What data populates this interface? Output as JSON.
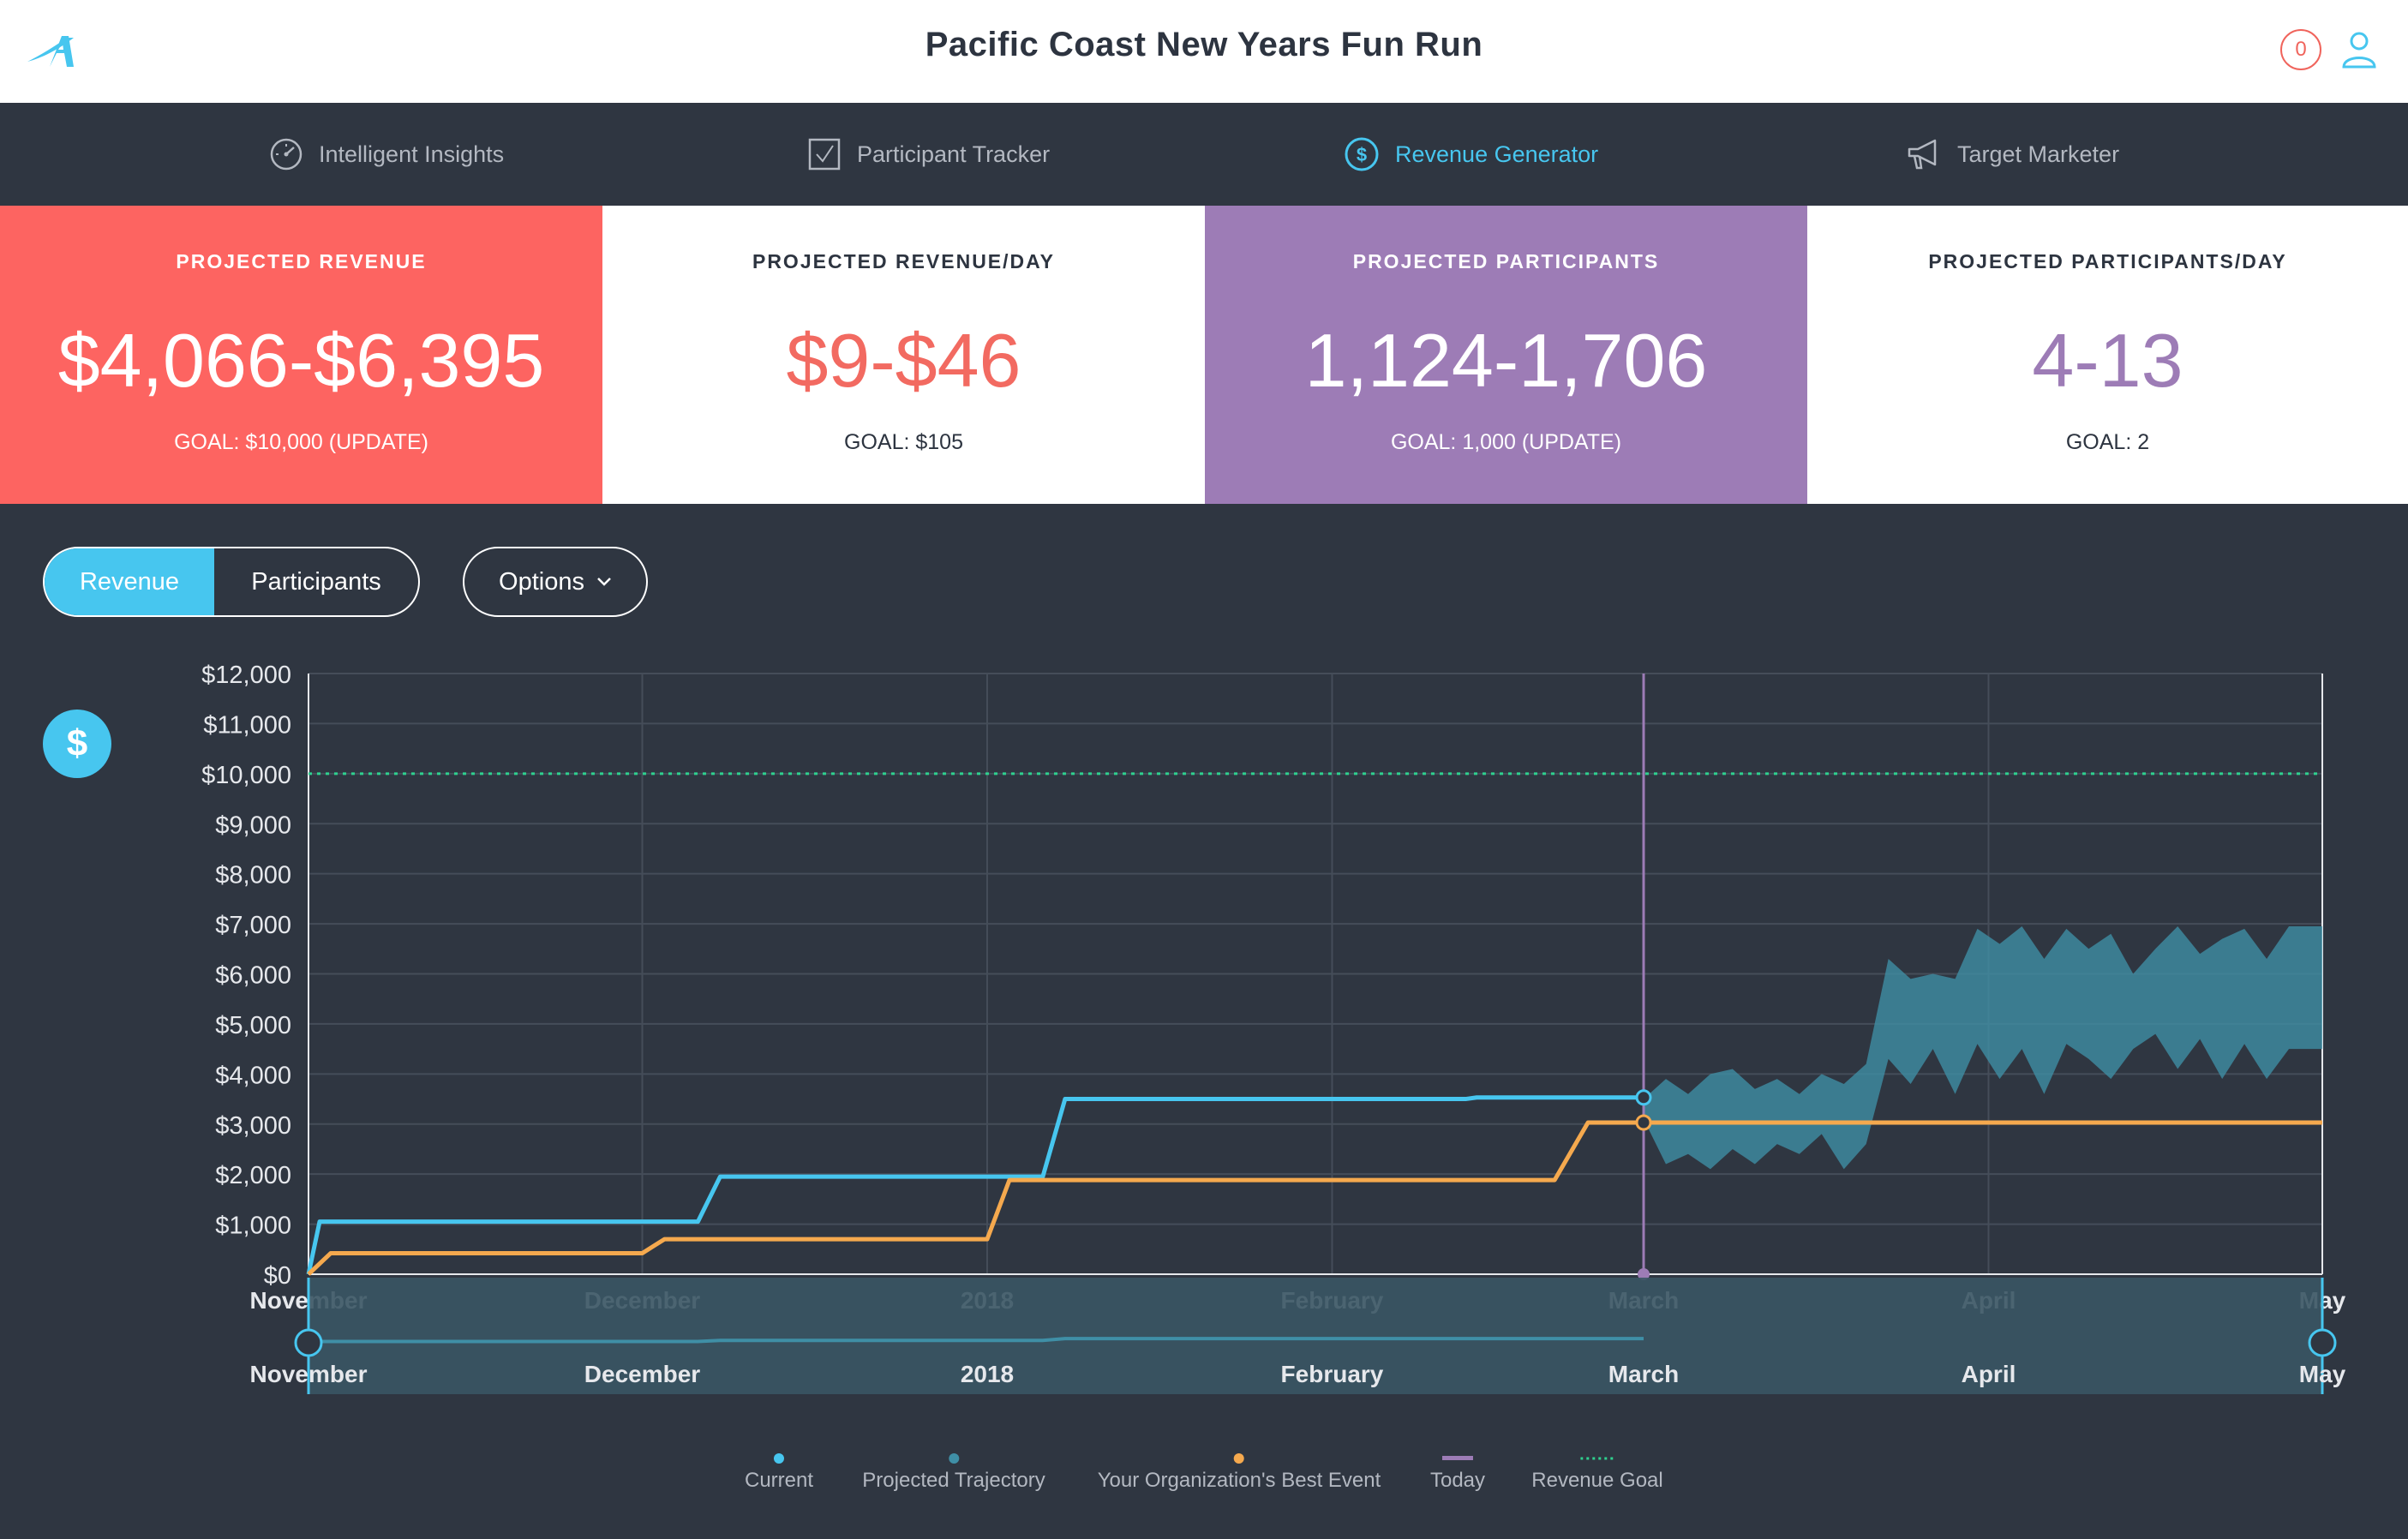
{
  "header": {
    "title": "Pacific Coast New Years Fun Run",
    "notification_count": "0",
    "logo_icon": "brand-logo-icon",
    "user_icon": "user-icon"
  },
  "nav": {
    "items": [
      {
        "label": "Intelligent Insights",
        "icon": "speedometer-icon",
        "active": false
      },
      {
        "label": "Participant Tracker",
        "icon": "checkbox-icon",
        "active": false
      },
      {
        "label": "Revenue Generator",
        "icon": "dollar-circle-icon",
        "active": true
      },
      {
        "label": "Target Marketer",
        "icon": "megaphone-icon",
        "active": false
      }
    ]
  },
  "cards": [
    {
      "label": "PROJECTED REVENUE",
      "value": "$4,066-$6,395",
      "goal": "GOAL: $10,000 (UPDATE)"
    },
    {
      "label": "PROJECTED REVENUE/DAY",
      "value": "$9-$46",
      "goal": "GOAL: $105"
    },
    {
      "label": "PROJECTED PARTICIPANTS",
      "value": "1,124-1,706",
      "goal": "GOAL: 1,000 (UPDATE)"
    },
    {
      "label": "PROJECTED PARTICIPANTS/DAY",
      "value": "4-13",
      "goal": "GOAL: 2"
    }
  ],
  "controls": {
    "toggle": [
      "Revenue",
      "Participants"
    ],
    "active_toggle": "Revenue",
    "options_label": "Options",
    "badge_symbol": "$"
  },
  "colors": {
    "current": "#47c6ef",
    "projected": "#3f8fa6",
    "best_event": "#f5a94e",
    "today": "#9d7cb6",
    "goal": "#2fd18f",
    "red": "#fd6461",
    "purple": "#9d7cb6"
  },
  "chart_data": {
    "type": "line",
    "y_ticks": [
      "$0",
      "$1,000",
      "$2,000",
      "$3,000",
      "$4,000",
      "$5,000",
      "$6,000",
      "$7,000",
      "$8,000",
      "$9,000",
      "$10,000",
      "$11,000",
      "$12,000"
    ],
    "ylim": [
      0,
      12000
    ],
    "x_ticks": [
      "November",
      "December",
      "2018",
      "February",
      "March",
      "April",
      "May"
    ],
    "xlim": [
      "2017-11-01",
      "2018-05-01"
    ],
    "today": "2018-03-01",
    "goal": 10000,
    "series": [
      {
        "name": "Current",
        "key": "current",
        "points": [
          [
            "2017-11-01",
            0
          ],
          [
            "2017-11-02",
            1050
          ],
          [
            "2017-12-06",
            1050
          ],
          [
            "2017-12-08",
            1950
          ],
          [
            "2018-01-06",
            1950
          ],
          [
            "2018-01-08",
            3500
          ],
          [
            "2018-02-13",
            3500
          ],
          [
            "2018-02-14",
            3530
          ],
          [
            "2018-03-01",
            3530
          ]
        ]
      },
      {
        "name": "Your Organization's Best Event",
        "key": "best_event",
        "points": [
          [
            "2017-11-01",
            0
          ],
          [
            "2017-11-03",
            420
          ],
          [
            "2017-12-01",
            420
          ],
          [
            "2017-12-03",
            700
          ],
          [
            "2018-01-01",
            700
          ],
          [
            "2018-01-03",
            1880
          ],
          [
            "2018-02-21",
            1880
          ],
          [
            "2018-02-24",
            3030
          ],
          [
            "2018-05-01",
            3030
          ]
        ]
      },
      {
        "name": "Projected Trajectory",
        "key": "projected",
        "band": [
          [
            "2018-03-01",
            3500,
            3100
          ],
          [
            "2018-03-03",
            3900,
            2200
          ],
          [
            "2018-03-05",
            3600,
            2400
          ],
          [
            "2018-03-07",
            4000,
            2100
          ],
          [
            "2018-03-09",
            4100,
            2500
          ],
          [
            "2018-03-11",
            3700,
            2200
          ],
          [
            "2018-03-13",
            3900,
            2600
          ],
          [
            "2018-03-15",
            3600,
            2400
          ],
          [
            "2018-03-17",
            4000,
            2800
          ],
          [
            "2018-03-19",
            3800,
            2100
          ],
          [
            "2018-03-21",
            4200,
            2600
          ],
          [
            "2018-03-23",
            6300,
            4300
          ],
          [
            "2018-03-25",
            5900,
            3800
          ],
          [
            "2018-03-27",
            6000,
            4500
          ],
          [
            "2018-03-29",
            5900,
            3600
          ],
          [
            "2018-03-31",
            6900,
            4600
          ],
          [
            "2018-04-02",
            6600,
            3900
          ],
          [
            "2018-04-04",
            6950,
            4500
          ],
          [
            "2018-04-06",
            6300,
            3600
          ],
          [
            "2018-04-08",
            6900,
            4600
          ],
          [
            "2018-04-10",
            6500,
            4300
          ],
          [
            "2018-04-12",
            6800,
            3900
          ],
          [
            "2018-04-14",
            6000,
            4500
          ],
          [
            "2018-04-16",
            6500,
            4800
          ],
          [
            "2018-04-18",
            6950,
            4100
          ],
          [
            "2018-04-20",
            6400,
            4700
          ],
          [
            "2018-04-22",
            6700,
            3900
          ],
          [
            "2018-04-24",
            6900,
            4600
          ],
          [
            "2018-04-26",
            6300,
            3900
          ],
          [
            "2018-04-28",
            6950,
            4500
          ]
        ]
      }
    ]
  },
  "legend": [
    {
      "label": "Current",
      "style": "dot",
      "color_key": "current"
    },
    {
      "label": "Projected Trajectory",
      "style": "dot",
      "color_key": "projected"
    },
    {
      "label": "Your Organization's Best Event",
      "style": "dot",
      "color_key": "best_event"
    },
    {
      "label": "Today",
      "style": "bar",
      "color_key": "today"
    },
    {
      "label": "Revenue Goal",
      "style": "dotted",
      "color_key": "goal"
    }
  ]
}
